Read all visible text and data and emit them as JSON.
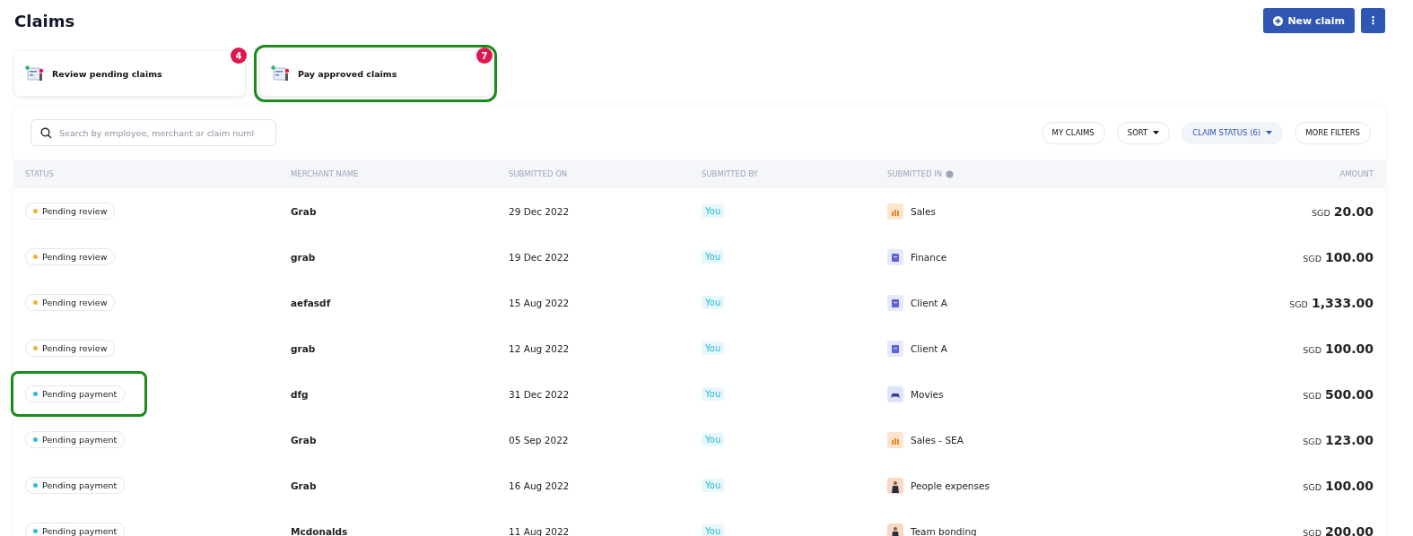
{
  "title": "Claims",
  "actions": {
    "new_claim": "New claim",
    "more": "⋮"
  },
  "tasks": [
    {
      "label": "Review pending claims",
      "count": "4",
      "highlighted": false
    },
    {
      "label": "Pay approved claims",
      "count": "7",
      "highlighted": true
    }
  ],
  "search": {
    "placeholder": "Search by employee, merchant or claim numl"
  },
  "filters": [
    {
      "label": "MY CLAIMS",
      "dropdown": false,
      "active": false
    },
    {
      "label": "SORT",
      "dropdown": true,
      "active": false
    },
    {
      "label": "CLAIM STATUS (6)",
      "dropdown": true,
      "active": true
    },
    {
      "label": "MORE FILTERS",
      "dropdown": false,
      "active": false
    }
  ],
  "table": {
    "columns": [
      "STATUS",
      "MERCHANT NAME",
      "SUBMITTED ON",
      "SUBMITTED BY",
      "SUBMITTED IN",
      "AMOUNT"
    ],
    "rows": [
      {
        "status": "Pending review",
        "color": "#f2b233",
        "highlighted": false,
        "merchant": "Grab",
        "date": "29 Dec 2022",
        "by": "You",
        "group": "Sales",
        "kind": "chart",
        "currency": "SGD",
        "amount": "20.00"
      },
      {
        "status": "Pending review",
        "color": "#f2b233",
        "highlighted": false,
        "merchant": "grab",
        "date": "19 Dec 2022",
        "by": "You",
        "group": "Finance",
        "kind": "document",
        "currency": "SGD",
        "amount": "100.00"
      },
      {
        "status": "Pending review",
        "color": "#f2b233",
        "highlighted": false,
        "merchant": "aefasdf",
        "date": "15 Aug 2022",
        "by": "You",
        "group": "Client A",
        "kind": "document",
        "currency": "SGD",
        "amount": "1,333.00"
      },
      {
        "status": "Pending review",
        "color": "#f2b233",
        "highlighted": false,
        "merchant": "grab",
        "date": "12 Aug 2022",
        "by": "You",
        "group": "Client A",
        "kind": "document",
        "currency": "SGD",
        "amount": "100.00"
      },
      {
        "status": "Pending payment",
        "color": "#2bbfd9",
        "highlighted": true,
        "merchant": "dfg",
        "date": "31 Dec 2022",
        "by": "You",
        "group": "Movies",
        "kind": "gamepad",
        "currency": "SGD",
        "amount": "500.00"
      },
      {
        "status": "Pending payment",
        "color": "#2bbfd9",
        "highlighted": false,
        "merchant": "Grab",
        "date": "05 Sep 2022",
        "by": "You",
        "group": "Sales - SEA",
        "kind": "chart",
        "currency": "SGD",
        "amount": "123.00"
      },
      {
        "status": "Pending payment",
        "color": "#2bbfd9",
        "highlighted": false,
        "merchant": "Grab",
        "date": "16 Aug 2022",
        "by": "You",
        "group": "People expenses",
        "kind": "person",
        "currency": "SGD",
        "amount": "100.00"
      },
      {
        "status": "Pending payment",
        "color": "#2bbfd9",
        "highlighted": false,
        "merchant": "Mcdonalds",
        "date": "11 Aug 2022",
        "by": "You",
        "group": "Team bonding",
        "kind": "person",
        "currency": "SGD",
        "amount": "200.00"
      }
    ]
  }
}
